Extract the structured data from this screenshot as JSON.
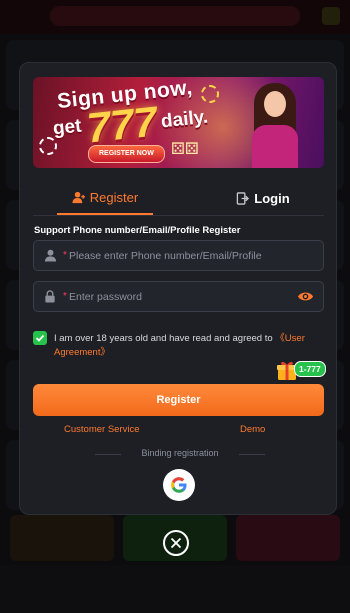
{
  "banner": {
    "line1": "Sign up now,",
    "line2": "get",
    "number": "777",
    "line3": "daily.",
    "button": "REGISTER NOW"
  },
  "tabs": [
    {
      "label": "Register",
      "icon": "user-plus-icon",
      "active": true
    },
    {
      "label": "Login",
      "icon": "login-door-icon",
      "active": false
    }
  ],
  "form": {
    "support_text": "Support Phone number/Email/Profile Register",
    "account_placeholder": "Please enter Phone number/Email/Profile",
    "password_placeholder": "Enter password",
    "required_mark": "*",
    "agree_text": "I am over 18 years old and have read and agreed to ",
    "agree_link": "《User Agreement》",
    "agree_checked": true,
    "gift_badge": "1-777",
    "register_button": "Register"
  },
  "links": {
    "customer_service": "Customer Service",
    "demo": "Demo"
  },
  "binding_label": "Binding registration",
  "colors": {
    "accent": "#ff7a2e",
    "success": "#27c24c",
    "modal_bg": "#1d1f25"
  }
}
